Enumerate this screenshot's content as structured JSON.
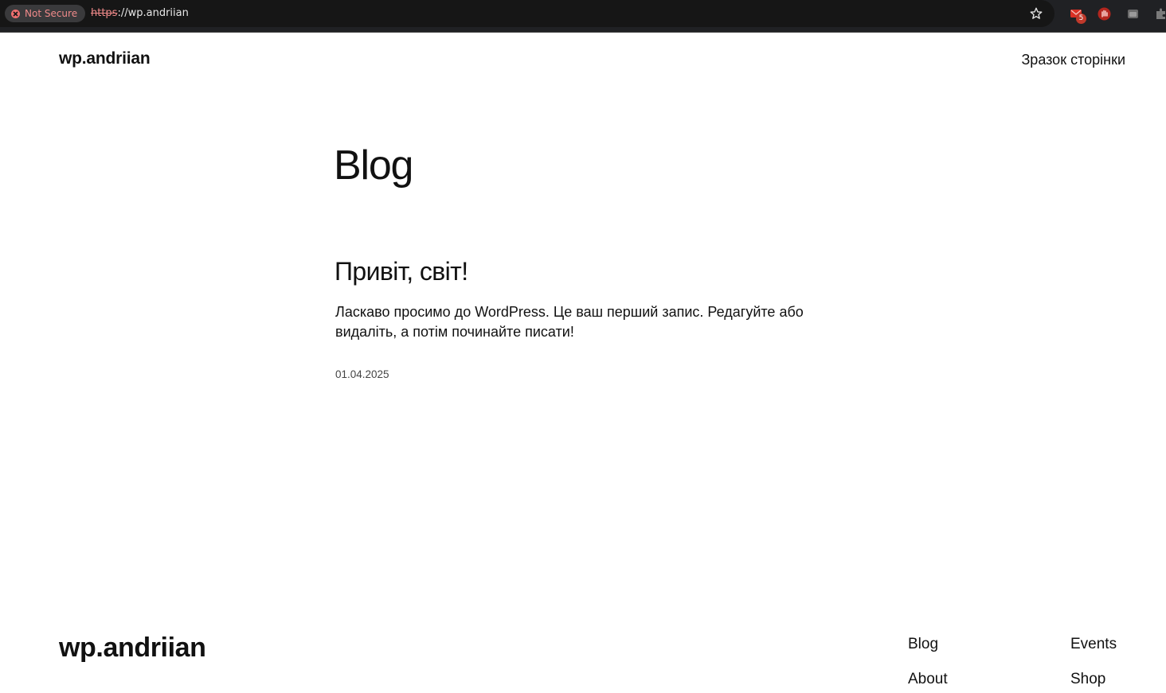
{
  "browser": {
    "security_label": "Not Secure",
    "url_scheme": "https",
    "url_rest": "://wp.andriian",
    "extension_badge_count": "5",
    "icons": [
      "warning-icon",
      "bookmark-star-icon",
      "extension-gmail-icon",
      "extension-hand-icon",
      "extension-window-icon",
      "extension-puzzle-icon"
    ]
  },
  "header": {
    "site_title": "wp.andriian",
    "nav_link": "Зразок сторінки"
  },
  "main": {
    "heading": "Blog",
    "posts": [
      {
        "title": "Привіт, світ!",
        "excerpt": "Ласкаво просимо до WordPress. Це ваш перший запис. Редагуйте або видаліть, а потім починайте писати!",
        "date": "01.04.2025"
      }
    ]
  },
  "footer": {
    "site_title": "wp.andriian",
    "links": [
      "Blog",
      "About",
      "Events",
      "Shop"
    ]
  }
}
